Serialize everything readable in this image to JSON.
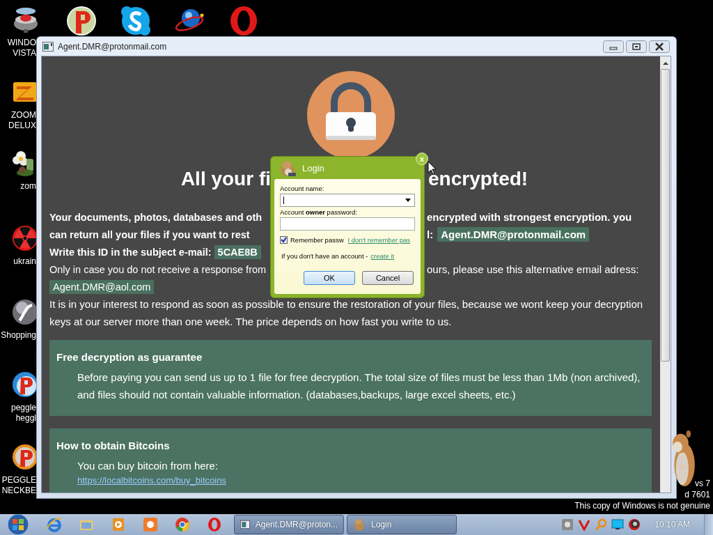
{
  "desktop": {
    "icons": [
      {
        "lines": [
          "WINDO",
          "VISTA"
        ]
      },
      {
        "lines": [
          "ZOOM",
          "DELUX"
        ]
      },
      {
        "lines": [
          "zom"
        ]
      },
      {
        "lines": [
          "ukrain"
        ]
      },
      {
        "lines": [
          "Shopping"
        ]
      },
      {
        "lines": [
          "peggle",
          "heggl"
        ]
      },
      {
        "lines": [
          "PEGGLE",
          "NECKBE"
        ]
      }
    ],
    "notice_lines": [
      "vs 7",
      "d 7601",
      "This copy of Windows is not genuine"
    ]
  },
  "window": {
    "title": "Agent.DMR@protonmail.com",
    "heading": {
      "left": "All your fi",
      "right": "encrypted!"
    },
    "lines": [
      {
        "left": [
          {
            "kind": "bold",
            "text": "Your documents, photos, databases and oth"
          }
        ],
        "right": [
          {
            "kind": "bold",
            "text": "encrypted with strongest encryption. you"
          }
        ]
      },
      {
        "left": [
          {
            "kind": "bold",
            "text": "can return all your files if you want to rest"
          }
        ],
        "right": [
          {
            "kind": "bold",
            "text": "l:"
          },
          {
            "kind": "highlight",
            "text": "Agent.DMR@protonmail.com"
          }
        ]
      },
      {
        "left": [
          {
            "kind": "bold",
            "text": "Write this ID in the subject e-mail:"
          },
          {
            "kind": "highlight",
            "text": "5CAE8B"
          }
        ]
      },
      {
        "left": [
          {
            "kind": "plain",
            "text": "Only in case you do not receive a response from"
          }
        ],
        "right": [
          {
            "kind": "plain",
            "text": "ours, please use this alternative email adress:"
          }
        ]
      },
      {
        "left": [
          {
            "kind": "highlight_plain",
            "text": "Agent.DMR@aol.com"
          }
        ]
      }
    ],
    "paragraph": "It is in your interest to respond as soon as possible to ensure the restoration of your files, because we wont keep your decryption keys at our server more than one week. The price depends on how fast you write to us.",
    "sections": [
      {
        "title": "Free decryption as guarantee",
        "body": "Before paying you can send us up to 1 file for free decryption. The total size of files must be less than 1Mb (non archived), and files should not contain valuable information. (databases,backups, large excel sheets, etc.)"
      },
      {
        "title": "How to obtain Bitcoins",
        "body": "You can buy bitcoin from here:",
        "link": "https://localbitcoins.com/buy_bitcoins"
      }
    ]
  },
  "dialog": {
    "title": "Login",
    "close": "x",
    "account_label": "Account name:",
    "password_label": "Account **owner** password:",
    "remember": {
      "label": "Remember passw",
      "checked": true
    },
    "forgot_link": "I don't remember pas",
    "signup_text": "If you don't have an account -",
    "signup_link": "create it",
    "buttons": [
      {
        "label": "OK",
        "focused": true
      },
      {
        "label": "Cancel",
        "focused": false
      }
    ]
  },
  "taskbar": {
    "buttons": [
      {
        "label": "Agent.DMR@proton..."
      },
      {
        "label": "Login"
      }
    ],
    "clock": "10:10 AM"
  }
}
